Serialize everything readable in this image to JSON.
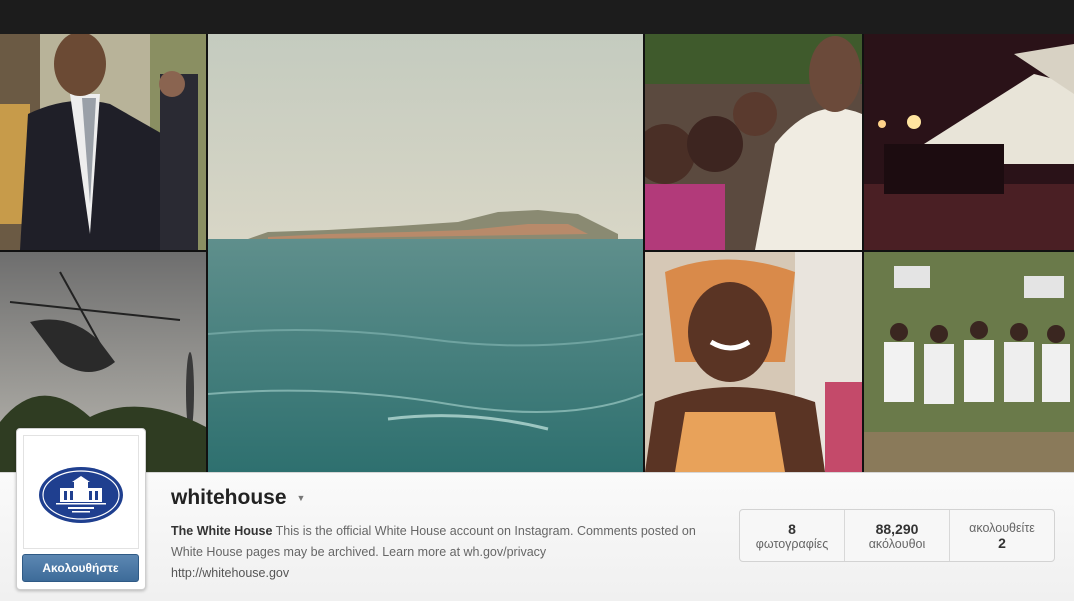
{
  "profile": {
    "username": "whitehouse",
    "display_name": "The White House",
    "bio": "This is the official White House account on Instagram. Comments posted on White House pages may be archived. Learn more at wh.gov/privacy",
    "website": "http://whitehouse.gov",
    "follow_label": "Ακολουθήστε"
  },
  "stats": [
    {
      "value": "8",
      "label": "φωτογραφίες"
    },
    {
      "value": "88,290",
      "label": "ακόλουθοι"
    },
    {
      "value": "2",
      "label": "ακολουθείτε"
    }
  ],
  "colors": {
    "follow_button": "#4a77a5",
    "top_bar": "#1c1c1c",
    "sea": "#3d7f7e"
  }
}
